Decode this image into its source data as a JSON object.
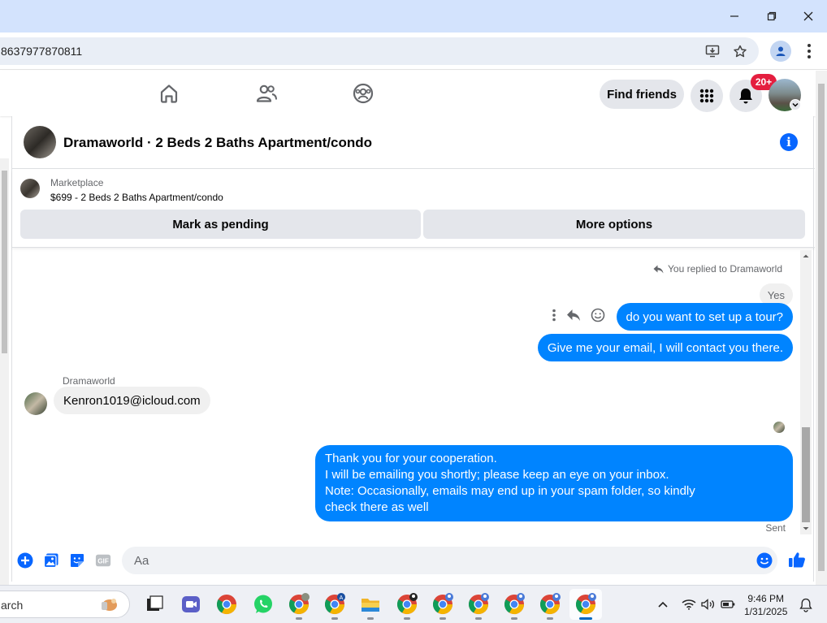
{
  "browser": {
    "url": "8637977870811",
    "window_buttons": [
      "minimize",
      "maximize",
      "close"
    ]
  },
  "fb_nav": {
    "find_friends_label": "Find friends",
    "notification_badge": "20+"
  },
  "chat": {
    "title": "Dramaworld · 2 Beds 2 Baths Apartment/condo",
    "marketplace": {
      "category": "Marketplace",
      "listing": "$699 - 2 Beds 2 Baths Apartment/condo",
      "mark_pending_label": "Mark as pending",
      "more_options_label": "More options"
    },
    "reply_indicator": "You replied to Dramaworld",
    "quoted_message": "Yes",
    "messages": [
      {
        "from": "me",
        "text": "do you want to set up a tour?"
      },
      {
        "from": "me",
        "text": "Give me your email, I will contact you there."
      },
      {
        "from": "Dramaworld",
        "text": "Kenron1019@icloud.com"
      },
      {
        "from": "me",
        "lines": [
          "Thank you for your cooperation.",
          "I will be emailing you shortly; please keep an eye on your inbox.",
          "Note: Occasionally, emails may end up in your spam folder, so kindly",
          "check there as well"
        ]
      }
    ],
    "sender_name": "Dramaworld",
    "status": "Sent",
    "composer_placeholder": "Aa"
  },
  "taskbar": {
    "search_text": "arch",
    "time": "9:46 PM",
    "date": "1/31/2025",
    "apps": [
      "file-explorer-task",
      "meet",
      "chrome",
      "whatsapp",
      "chrome",
      "chrome",
      "file-explorer",
      "chrome",
      "chrome",
      "chrome",
      "chrome",
      "chrome",
      "chrome"
    ]
  },
  "colors": {
    "messenger_blue": "#0084ff",
    "fb_blue": "#0866ff",
    "badge_red": "#e41e3f"
  }
}
